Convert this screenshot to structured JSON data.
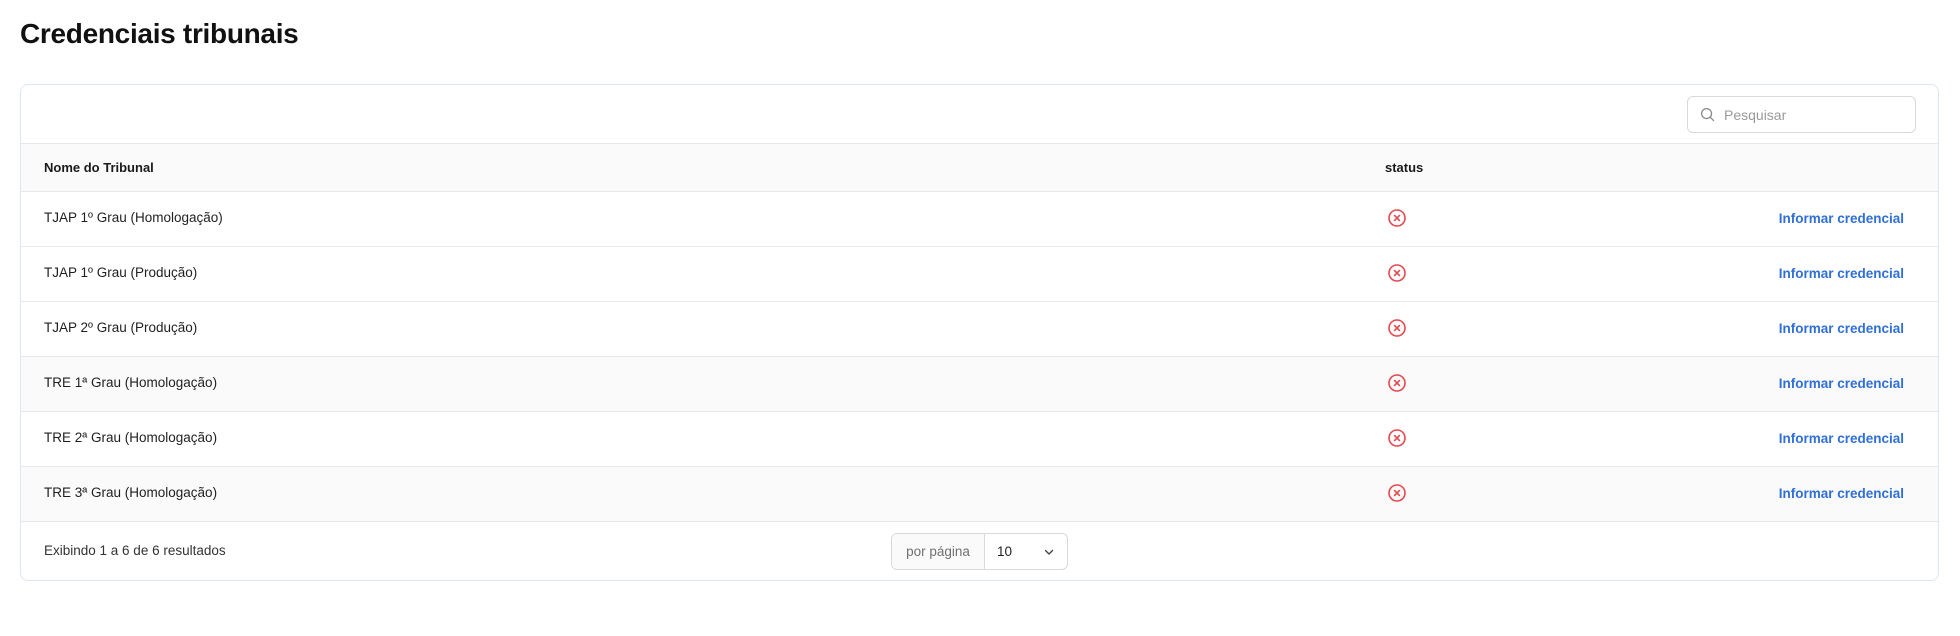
{
  "page": {
    "title": "Credenciais tribunais"
  },
  "search": {
    "placeholder": "Pesquisar",
    "value": ""
  },
  "table": {
    "columns": {
      "name": "Nome do Tribunal",
      "status": "status"
    },
    "rows": [
      {
        "name": "TJAP 1º Grau (Homologação)",
        "status": "error",
        "action": "Informar credencial"
      },
      {
        "name": "TJAP 1º Grau (Produção)",
        "status": "error",
        "action": "Informar credencial"
      },
      {
        "name": "TJAP 2º Grau (Produção)",
        "status": "error",
        "action": "Informar credencial"
      },
      {
        "name": "TRE 1ª Grau (Homologação)",
        "status": "error",
        "action": "Informar credencial"
      },
      {
        "name": "TRE 2ª Grau (Homologação)",
        "status": "error",
        "action": "Informar credencial"
      },
      {
        "name": "TRE 3ª Grau (Homologação)",
        "status": "error",
        "action": "Informar credencial"
      }
    ]
  },
  "footer": {
    "result_text": "Exibindo 1 a 6 de 6 resultados",
    "per_page_label": "por página",
    "per_page_value": "10"
  },
  "colors": {
    "accent_link": "#2f6fd6",
    "status_error": "#e5484d",
    "card_border": "#dde6f2"
  },
  "icons": {
    "search": "search-icon",
    "status": "x-circle-icon",
    "dropdown": "chevron-down-icon"
  }
}
